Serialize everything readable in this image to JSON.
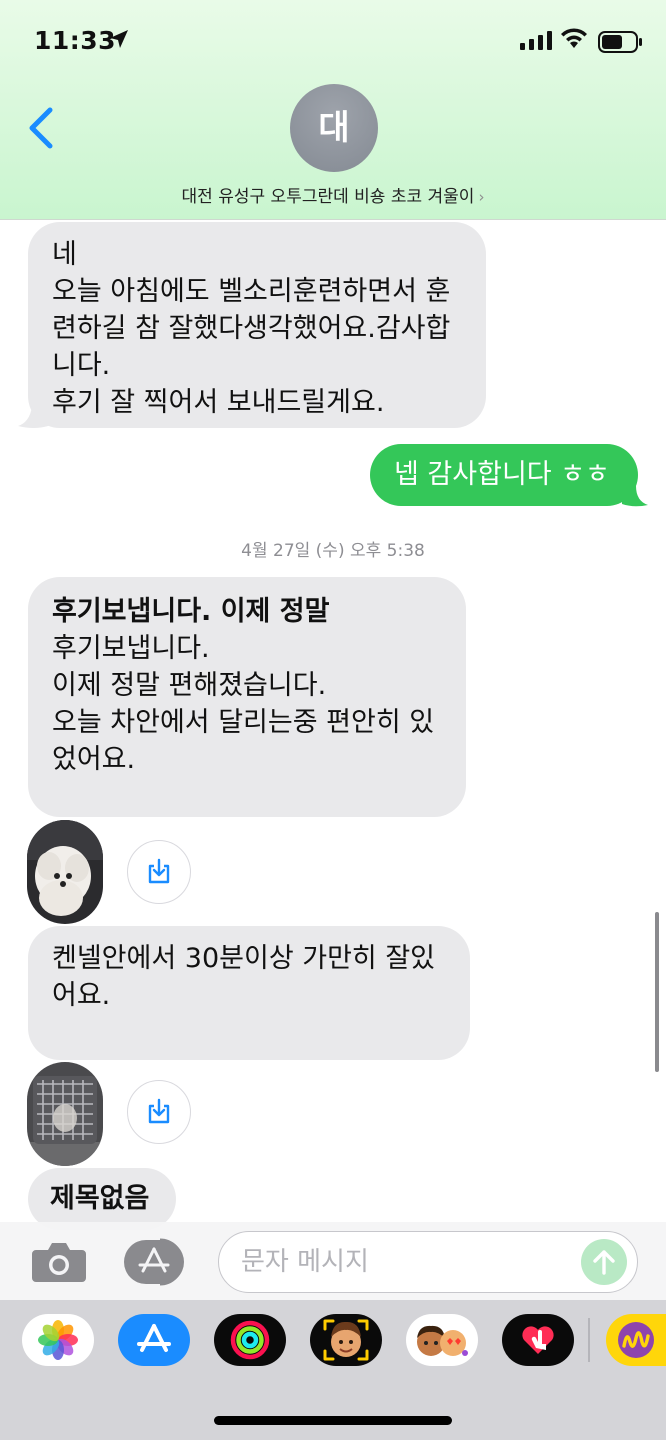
{
  "status_bar": {
    "time": "11:33"
  },
  "header": {
    "avatar_initial": "대",
    "contact_name": "대전 유성구 오투그란데 비숑 초코 겨울이",
    "contact_chevron": "›"
  },
  "messages": [
    {
      "direction": "received",
      "lines": [
        "네",
        "오늘 아침에도 벨소리훈련하면서 훈",
        "련하길 참 잘했다생각했어요.감사합",
        "니다.",
        "후기 잘 찍어서 보내드릴게요."
      ]
    },
    {
      "direction": "sent",
      "text": "넵 감사합니다 ㅎㅎ"
    },
    {
      "type": "timestamp",
      "text": "4월 27일 (수) 오후 5:38"
    },
    {
      "direction": "received",
      "subject": "후기보냅니다. 이제 정말",
      "lines": [
        "후기보냅니다.",
        "이제 정말 편해졌습니다.",
        "오늘 차안에서 달리는중 편안히 있",
        "었어요."
      ]
    },
    {
      "direction": "received",
      "type": "media",
      "icon": "dog-photo-thumbnail"
    },
    {
      "direction": "received",
      "lines": [
        "켄넬안에서 30분이상 가만히 잘있",
        "어요."
      ]
    },
    {
      "direction": "received",
      "type": "media",
      "icon": "kennel-photo-thumbnail"
    },
    {
      "direction": "received",
      "text": "제목없음"
    }
  ],
  "compose": {
    "placeholder": "문자 메시지",
    "value": ""
  },
  "app_drawer": {
    "apps": [
      "photos-app-icon",
      "app-store-icon",
      "fitness-icon",
      "memoji-icon",
      "memoji-stickers-icon",
      "digital-touch-icon",
      "music-app-icon"
    ]
  },
  "colors": {
    "header_bg": "#d6f7d9",
    "sent_bubble": "#34c759",
    "received_bubble": "#e9e9eb",
    "accent_blue": "#1a8cff"
  }
}
